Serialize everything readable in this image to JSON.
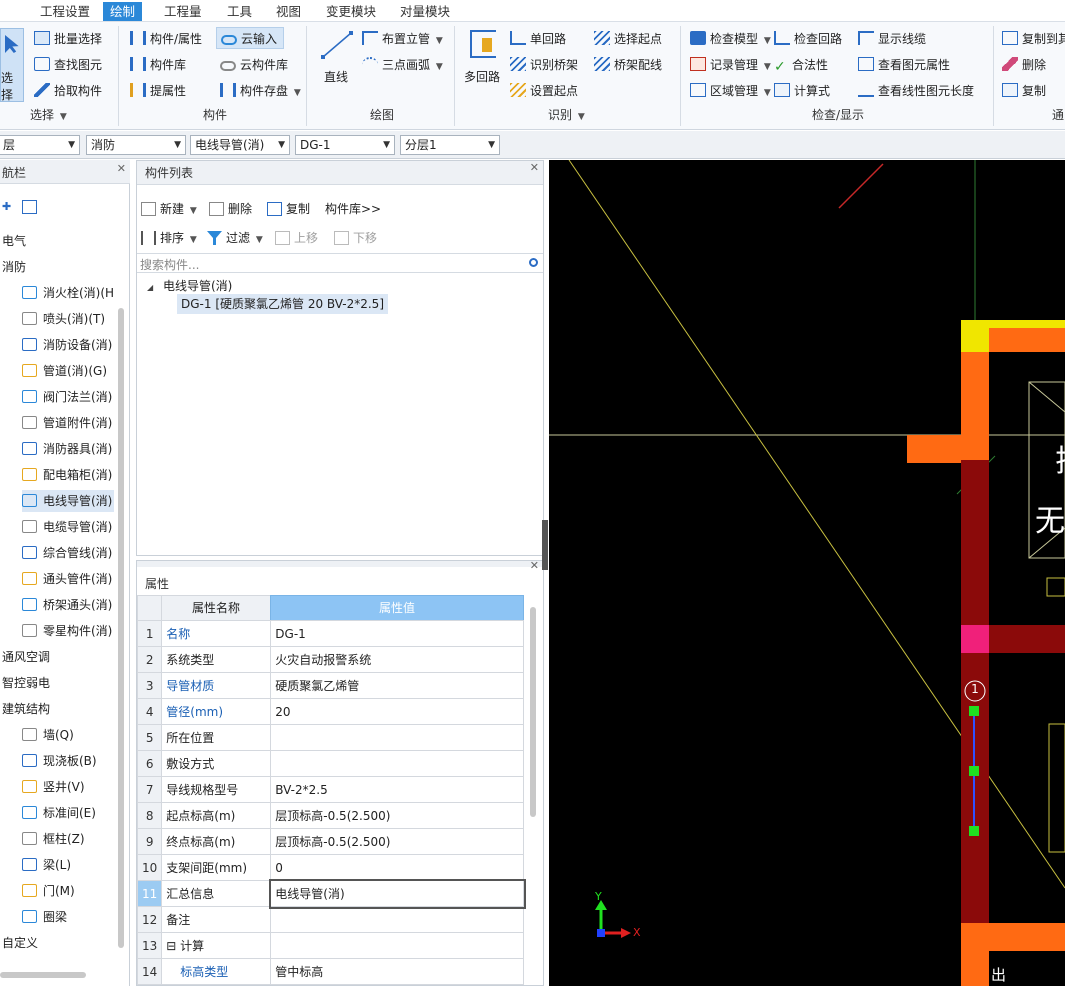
{
  "menu": {
    "items": [
      "工程设置",
      "绘制",
      "工程量",
      "工具",
      "视图",
      "变更模块",
      "对量模块"
    ],
    "active_index": 1
  },
  "ribbon": {
    "select_big": "选择",
    "select_group": [
      "批量选择",
      "查找图元",
      "拾取构件"
    ],
    "select_group_label": "选择",
    "component_group": [
      "构件/属性",
      "构件库",
      "提属性",
      "云输入",
      "云构件库",
      "构件存盘"
    ],
    "component_group_label": "构件",
    "draw_line": "直线",
    "draw_group": [
      "布置立管",
      "三点画弧"
    ],
    "draw_group_label": "绘图",
    "multi_loop": "多回路",
    "identify_group": [
      "单回路",
      "识别桥架",
      "设置起点",
      "选择起点",
      "桥架配线"
    ],
    "identify_group_label": "识别",
    "check_group": [
      "检查模型",
      "记录管理",
      "区域管理",
      "检查回路",
      "合法性",
      "计算式",
      "显示线缆",
      "查看图元属性",
      "查看线性图元长度"
    ],
    "check_group_label": "检查/显示",
    "edit_group": [
      "复制到其",
      "删除",
      "复制"
    ],
    "edit_group_label": "通"
  },
  "combos": [
    "层",
    "消防",
    "电线导管(消)",
    "DG-1",
    "分层1"
  ],
  "nav": {
    "title": "航栏",
    "items": [
      {
        "label": "电气",
        "level": 0
      },
      {
        "label": "消防",
        "level": 0
      },
      {
        "label": "消火栓(消)(H",
        "level": 1,
        "icon": "hydrant-icon"
      },
      {
        "label": "喷头(消)(T)",
        "level": 1,
        "icon": "sprinkler-icon"
      },
      {
        "label": "消防设备(消)",
        "level": 1,
        "icon": "fire-equipment-icon"
      },
      {
        "label": "管道(消)(G)",
        "level": 1,
        "icon": "pipe-icon"
      },
      {
        "label": "阀门法兰(消)",
        "level": 1,
        "icon": "valve-icon"
      },
      {
        "label": "管道附件(消)",
        "level": 1,
        "icon": "pipe-fitting-icon"
      },
      {
        "label": "消防器具(消)",
        "level": 1,
        "icon": "fire-appliance-icon"
      },
      {
        "label": "配电箱柜(消)",
        "level": 1,
        "icon": "distribution-box-icon"
      },
      {
        "label": "电线导管(消)",
        "level": 1,
        "icon": "conduit-icon",
        "selected": true
      },
      {
        "label": "电缆导管(消)",
        "level": 1,
        "icon": "cable-conduit-icon"
      },
      {
        "label": "综合管线(消)",
        "level": 1,
        "icon": "combined-pipeline-icon"
      },
      {
        "label": "通头管件(消)",
        "level": 1,
        "icon": "tee-fitting-icon"
      },
      {
        "label": "桥架通头(消)",
        "level": 1,
        "icon": "tray-tee-icon"
      },
      {
        "label": "零星构件(消)",
        "level": 1,
        "icon": "misc-component-icon"
      },
      {
        "label": "通风空调",
        "level": 0
      },
      {
        "label": "智控弱电",
        "level": 0
      },
      {
        "label": "建筑结构",
        "level": 0
      },
      {
        "label": "墙(Q)",
        "level": 1,
        "icon": "wall-icon"
      },
      {
        "label": "现浇板(B)",
        "level": 1,
        "icon": "slab-icon"
      },
      {
        "label": "竖井(V)",
        "level": 1,
        "icon": "shaft-icon"
      },
      {
        "label": "标准间(E)",
        "level": 1,
        "icon": "standard-room-icon"
      },
      {
        "label": "框柱(Z)",
        "level": 1,
        "icon": "column-icon"
      },
      {
        "label": "梁(L)",
        "level": 1,
        "icon": "beam-icon"
      },
      {
        "label": "门(M)",
        "level": 1,
        "icon": "door-icon"
      },
      {
        "label": "圈梁",
        "level": 1,
        "icon": "ring-beam-icon"
      },
      {
        "label": "自定义",
        "level": 0
      }
    ]
  },
  "component_list": {
    "title": "构件列表",
    "toolbar": {
      "new": "新建",
      "delete": "删除",
      "copy": "复制",
      "library": "构件库>>",
      "sort": "排序",
      "filter": "过滤",
      "up": "上移",
      "down": "下移"
    },
    "search_placeholder": "搜索构件...",
    "tree_root": "电线导管(消)",
    "tree_child": "DG-1 [硬质聚氯乙烯管 20 BV-2*2.5]"
  },
  "properties": {
    "title": "属性",
    "col_name": "属性名称",
    "col_value": "属性值",
    "rows": [
      {
        "n": "1",
        "name": "名称",
        "value": "DG-1",
        "blue": true
      },
      {
        "n": "2",
        "name": "系统类型",
        "value": "火灾自动报警系统",
        "blue": false
      },
      {
        "n": "3",
        "name": "导管材质",
        "value": "硬质聚氯乙烯管",
        "blue": true
      },
      {
        "n": "4",
        "name": "管径(mm)",
        "value": "20",
        "blue": true
      },
      {
        "n": "5",
        "name": "所在位置",
        "value": "",
        "blue": false
      },
      {
        "n": "6",
        "name": "敷设方式",
        "value": "",
        "blue": false
      },
      {
        "n": "7",
        "name": "导线规格型号",
        "value": "BV-2*2.5",
        "blue": false
      },
      {
        "n": "8",
        "name": "起点标高(m)",
        "value": "层顶标高-0.5(2.500)",
        "blue": false
      },
      {
        "n": "9",
        "name": "终点标高(m)",
        "value": "层顶标高-0.5(2.500)",
        "blue": false
      },
      {
        "n": "10",
        "name": "支架间距(mm)",
        "value": "0",
        "blue": false
      },
      {
        "n": "11",
        "name": "汇总信息",
        "value": "电线导管(消)",
        "blue": false
      },
      {
        "n": "12",
        "name": "备注",
        "value": "",
        "blue": false
      },
      {
        "n": "13",
        "name": "⊟ 计算",
        "value": "",
        "blue": false
      },
      {
        "n": "14",
        "name": "标高类型",
        "value": "管中标高",
        "blue": true
      }
    ]
  },
  "canvas": {
    "marker_label": "1",
    "axis_x": "X",
    "axis_y": "Y",
    "room_text_1": "无",
    "room_text_2": "拉",
    "side_text": "出"
  }
}
